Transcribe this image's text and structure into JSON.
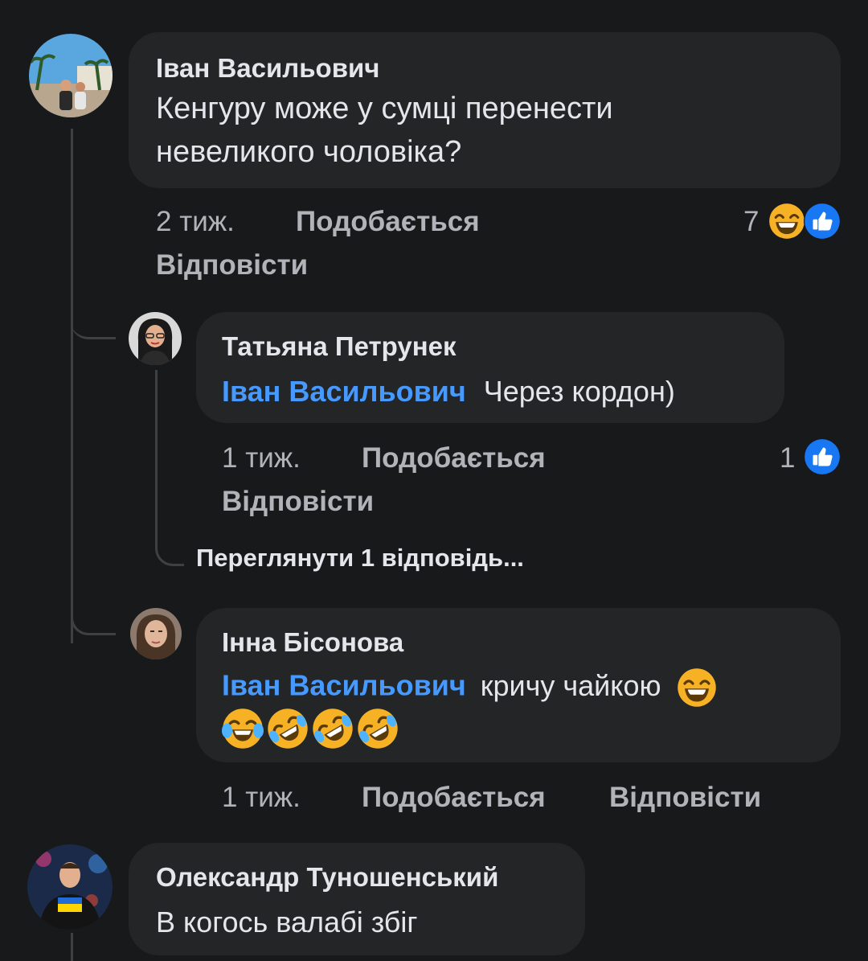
{
  "comments": [
    {
      "author": "Іван Васильович",
      "text_line1": "Кенгуру може у сумці перенести",
      "text_line2": "невеликого чоловіка?",
      "time": "2 тиж.",
      "like_label": "Подобається",
      "reply_label": "Відповісти",
      "reaction_count": "7",
      "reactions": [
        "haha-reaction-icon",
        "like-reaction-icon"
      ]
    },
    {
      "author": "Татьяна Петрунек",
      "mention": "Іван Васильович",
      "text": "Через кордон)",
      "time": "1 тиж.",
      "like_label": "Подобається",
      "reply_label": "Відповісти",
      "reaction_count": "1",
      "reactions": [
        "like-reaction-icon"
      ],
      "view_replies": "Переглянути 1 відповідь..."
    },
    {
      "author": "Інна Бісонова",
      "mention": "Іван Васильович",
      "text": "кричу чайкою",
      "emojis": [
        "grinning-squinting-emoji",
        "tears-of-joy-emoji",
        "rolling-laughing-emoji",
        "rolling-laughing-emoji",
        "rolling-laughing-emoji"
      ],
      "time": "1 тиж.",
      "like_label": "Подобається",
      "reply_label": "Відповісти"
    },
    {
      "author": "Олександр Туношенський",
      "text": "В когось валабі збіг"
    }
  ],
  "colors": {
    "background": "#18191a",
    "bubble": "#242526",
    "mention": "#4599ff",
    "meta": "#b0b3b8",
    "like_blue": "#1877f2"
  }
}
